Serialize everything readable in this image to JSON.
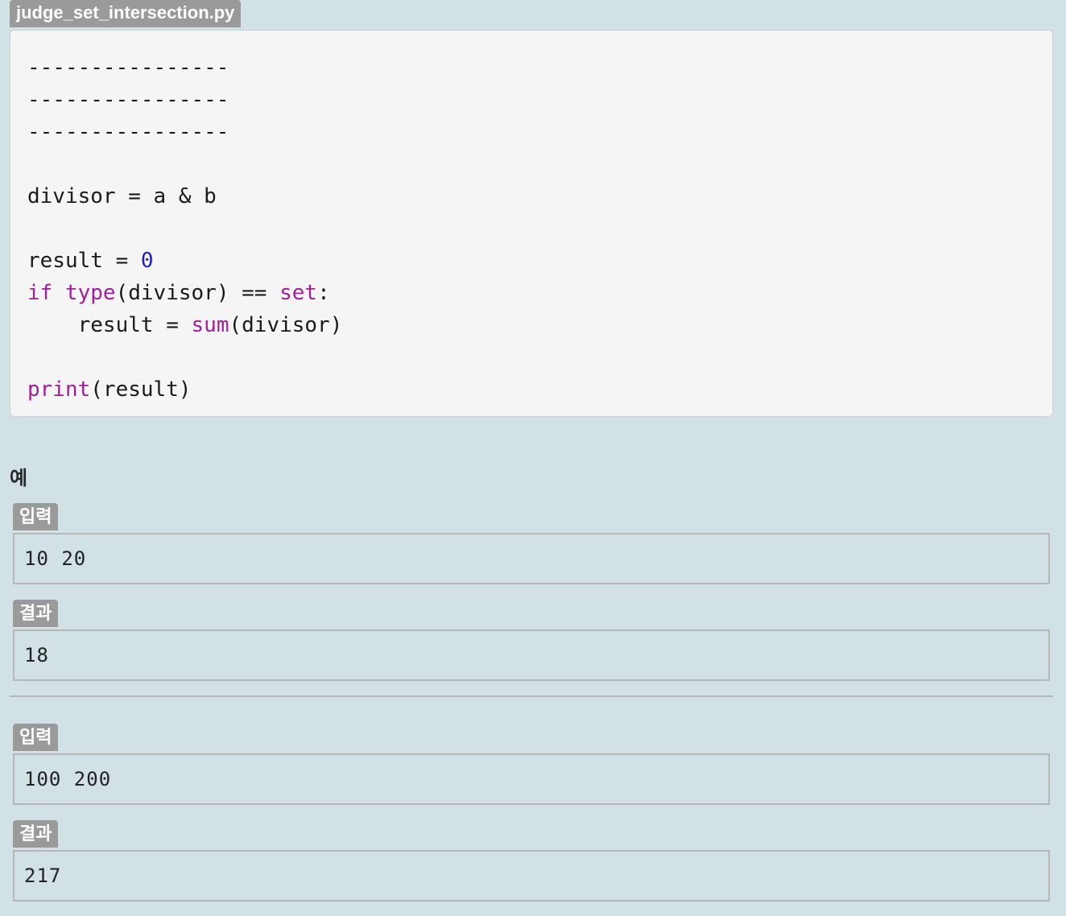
{
  "file_tab": {
    "label": "judge_set_intersection.py"
  },
  "code": {
    "placeholder_lines": [
      "----------------",
      "----------------",
      "----------------"
    ],
    "line_divisor": {
      "name": "divisor",
      "op": " = ",
      "expr": "a & b"
    },
    "line_result_init": {
      "name": "result",
      "op": " = ",
      "value": "0"
    },
    "line_if": {
      "kw_if": "if",
      "fn_type": "type",
      "args": "(divisor) == ",
      "kw_set": "set",
      "colon": ":"
    },
    "line_sum": {
      "indent": "    ",
      "name": "result",
      "op": " = ",
      "fn_sum": "sum",
      "args": "(divisor)"
    },
    "line_print": {
      "fn_print": "print",
      "args": "(result)"
    }
  },
  "examples": {
    "title": "예",
    "input_label": "입력",
    "output_label": "결과",
    "cases": [
      {
        "input": "10 20",
        "output": "18"
      },
      {
        "input": "100 200",
        "output": "217"
      }
    ]
  }
}
